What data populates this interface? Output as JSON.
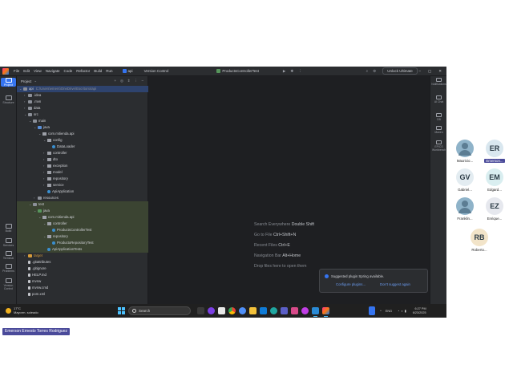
{
  "ide": {
    "menu": [
      "File",
      "Edit",
      "View",
      "Navigate",
      "Code",
      "Refactor",
      "Build",
      "Run"
    ],
    "project_name": "api",
    "version_control": "Version Control",
    "run_config": "ProductsControllerTest",
    "unlock_label": "Unlock Ultimate",
    "left_tools": [
      "Project",
      "Structure",
      "Build",
      "Services",
      "Terminal",
      "Problems",
      "Version Control"
    ],
    "right_tools": [
      "Notifications",
      "AI Chat",
      "DB",
      "Maven",
      "EPICS Workbench"
    ],
    "panel_title": "Project",
    "tree": [
      {
        "label": "api",
        "extra": "C:\\Users\\emers\\OneDrive\\Escritorio\\api",
        "depth": 0,
        "arrow": "v",
        "icon": "folder",
        "state": "selected"
      },
      {
        "label": ".idea",
        "depth": 1,
        "arrow": ">",
        "icon": "folder"
      },
      {
        "label": ".mvn",
        "depth": 1,
        "arrow": ">",
        "icon": "folder"
      },
      {
        "label": "data",
        "depth": 1,
        "arrow": ">",
        "icon": "folder"
      },
      {
        "label": "src",
        "depth": 1,
        "arrow": "v",
        "icon": "folder"
      },
      {
        "label": "main",
        "depth": 2,
        "arrow": "v",
        "icon": "folder"
      },
      {
        "label": "java",
        "depth": 3,
        "arrow": "v",
        "icon": "src"
      },
      {
        "label": "com.mitienda.api",
        "depth": 4,
        "arrow": "v",
        "icon": "pkg"
      },
      {
        "label": "config",
        "depth": 5,
        "arrow": "v",
        "icon": "pkg"
      },
      {
        "label": "DataLoader",
        "depth": 6,
        "arrow": "",
        "icon": "java"
      },
      {
        "label": "controller",
        "depth": 5,
        "arrow": ">",
        "icon": "pkg"
      },
      {
        "label": "dto",
        "depth": 5,
        "arrow": ">",
        "icon": "pkg"
      },
      {
        "label": "exception",
        "depth": 5,
        "arrow": ">",
        "icon": "pkg"
      },
      {
        "label": "model",
        "depth": 5,
        "arrow": ">",
        "icon": "pkg"
      },
      {
        "label": "repository",
        "depth": 5,
        "arrow": ">",
        "icon": "pkg"
      },
      {
        "label": "service",
        "depth": 5,
        "arrow": ">",
        "icon": "pkg"
      },
      {
        "label": "ApiApplication",
        "depth": 5,
        "arrow": "",
        "icon": "java"
      },
      {
        "label": "resources",
        "depth": 3,
        "arrow": ">",
        "icon": "folder"
      },
      {
        "label": "test",
        "depth": 2,
        "arrow": "v",
        "icon": "folder",
        "state": "test"
      },
      {
        "label": "java",
        "depth": 3,
        "arrow": "v",
        "icon": "test",
        "state": "test"
      },
      {
        "label": "com.mitienda.api",
        "depth": 4,
        "arrow": "v",
        "icon": "pkg",
        "state": "test"
      },
      {
        "label": "controller",
        "depth": 5,
        "arrow": "v",
        "icon": "pkg",
        "state": "test"
      },
      {
        "label": "ProductsControllerTest",
        "depth": 6,
        "arrow": "",
        "icon": "java",
        "state": "test"
      },
      {
        "label": "repository",
        "depth": 5,
        "arrow": "v",
        "icon": "pkg",
        "state": "test"
      },
      {
        "label": "ProductoRepositoryTest",
        "depth": 6,
        "arrow": "",
        "icon": "java",
        "state": "test"
      },
      {
        "label": "ApiApplicationTests",
        "depth": 5,
        "arrow": "",
        "icon": "java",
        "state": "test"
      },
      {
        "label": "target",
        "depth": 1,
        "arrow": ">",
        "icon": "exclude"
      },
      {
        "label": ".gitattributes",
        "depth": 1,
        "arrow": "",
        "icon": "file"
      },
      {
        "label": ".gitignore",
        "depth": 1,
        "arrow": "",
        "icon": "file"
      },
      {
        "label": "HELP.md",
        "depth": 1,
        "arrow": "",
        "icon": "file"
      },
      {
        "label": "mvnw",
        "depth": 1,
        "arrow": "",
        "icon": "file"
      },
      {
        "label": "mvnw.cmd",
        "depth": 1,
        "arrow": "",
        "icon": "file"
      },
      {
        "label": "pom.xml",
        "depth": 1,
        "arrow": "",
        "icon": "file"
      }
    ],
    "hints": [
      {
        "label": "Search Everywhere",
        "key": "Double Shift"
      },
      {
        "label": "Go to File",
        "key": "Ctrl+Shift+N"
      },
      {
        "label": "Recent Files",
        "key": "Ctrl+E"
      },
      {
        "label": "Navigation Bar",
        "key": "Alt+Home"
      },
      {
        "label": "Drop files here to open them",
        "key": ""
      }
    ],
    "notification": {
      "title": "Suggested plugin Spring available.",
      "action1": "Configure plugins...",
      "action2": "Don't suggest again"
    }
  },
  "taskbar": {
    "weather_temp": "17°C",
    "weather_desc": "Mayorm. soleado",
    "search_placeholder": "Search",
    "lang": "ENG",
    "time": "6:27 PM",
    "date": "6/23/2025"
  },
  "participants": [
    {
      "initials": "",
      "name": "Mauricio...",
      "color": "#8fb3c9"
    },
    {
      "initials": "ER",
      "name": "Emerson...",
      "color": "#d9e7ef"
    },
    {
      "initials": "GV",
      "name": "Gabriel...",
      "color": "#e3ecf1"
    },
    {
      "initials": "EM",
      "name": "Edgard...",
      "color": "#d9eef0"
    },
    {
      "initials": "",
      "name": "Franklin...",
      "color": "#8fb3c9"
    },
    {
      "initials": "EZ",
      "name": "Enrique...",
      "color": "#e6e8ee"
    },
    {
      "initials": "RB",
      "name": "Roberto...",
      "color": "#f2e4c9"
    }
  ],
  "speaker_name": "Emerson Ernesto Torres Rodriguez"
}
